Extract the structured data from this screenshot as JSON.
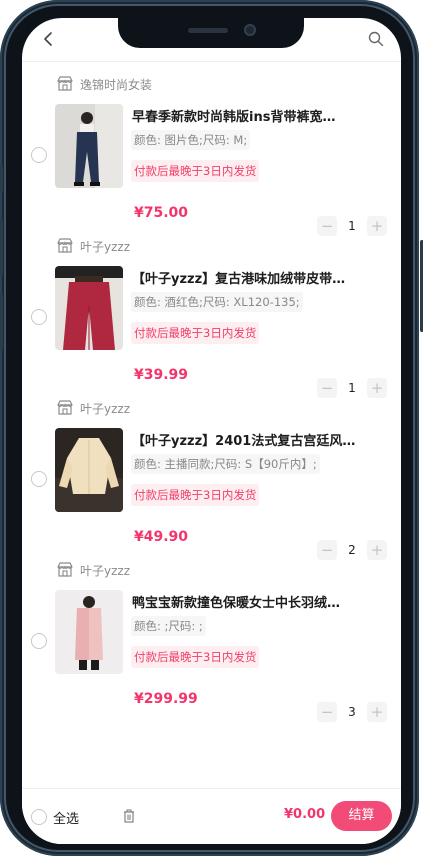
{
  "header": {
    "back_icon": "chevron-left-icon",
    "search_icon": "search-icon"
  },
  "cart": {
    "items": [
      {
        "shop": "逸锦时尚女装",
        "title": "早春季新款时尚韩版ins背带裤宽…",
        "spec": "颜色: 图片色;尺码: M;",
        "ship": "付款后最晚于3日内发货",
        "price": "¥75.00",
        "qty": "1"
      },
      {
        "shop": "叶子yzzz",
        "title": "【叶子yzzz】复古港味加绒带皮带…",
        "spec": "颜色: 酒红色;尺码: XL120-135;",
        "ship": "付款后最晚于3日内发货",
        "price": "¥39.99",
        "qty": "1"
      },
      {
        "shop": "叶子yzzz",
        "title": "【叶子yzzz】2401法式复古宫廷风…",
        "spec": "颜色: 主播同款;尺码: S【90斤内】;",
        "ship": "付款后最晚于3日内发货",
        "price": "¥49.90",
        "qty": "2"
      },
      {
        "shop": "叶子yzzz",
        "title": "鸭宝宝新款撞色保暖女士中长羽绒…",
        "spec": "颜色: ;尺码: ;",
        "ship": "付款后最晚于3日内发货",
        "price": "¥299.99",
        "qty": "3"
      }
    ],
    "minus_label": "−",
    "plus_label": "+"
  },
  "footer": {
    "select_all": "全选",
    "delete_icon": "trash-icon",
    "total": "¥0.00",
    "checkout": "结算"
  },
  "colors": {
    "accent": "#f2366b",
    "checkout_bg": "#f24b78",
    "ship_bg": "#fdeef1"
  }
}
